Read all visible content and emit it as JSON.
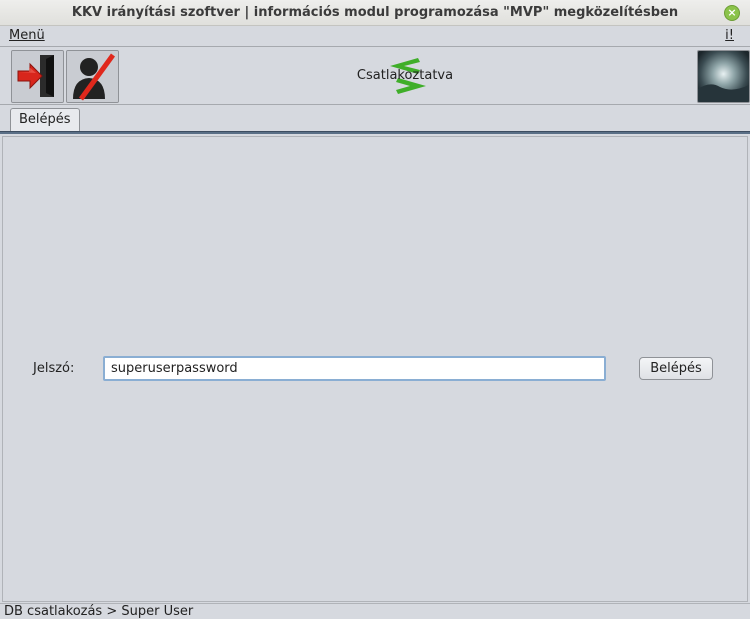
{
  "window": {
    "title": "KKV irányítási szoftver | információs modul programozása \"MVP\" megközelítésben"
  },
  "menubar": {
    "left_menu": "Menü",
    "right_menu": "i!"
  },
  "toolbar": {
    "connection_status": "Csatlakoztatva",
    "status_color": "#3fae29"
  },
  "tabs": [
    {
      "label": "Belépés",
      "active": true
    }
  ],
  "login_form": {
    "password_label": "Jelszó:",
    "password_value": "superuserpassword",
    "login_button_label": "Belépés"
  },
  "statusbar": {
    "text": "DB csatlakozás > Super User"
  },
  "colors": {
    "accent": "#5a6f86",
    "input_focus": "#8aaed3"
  }
}
